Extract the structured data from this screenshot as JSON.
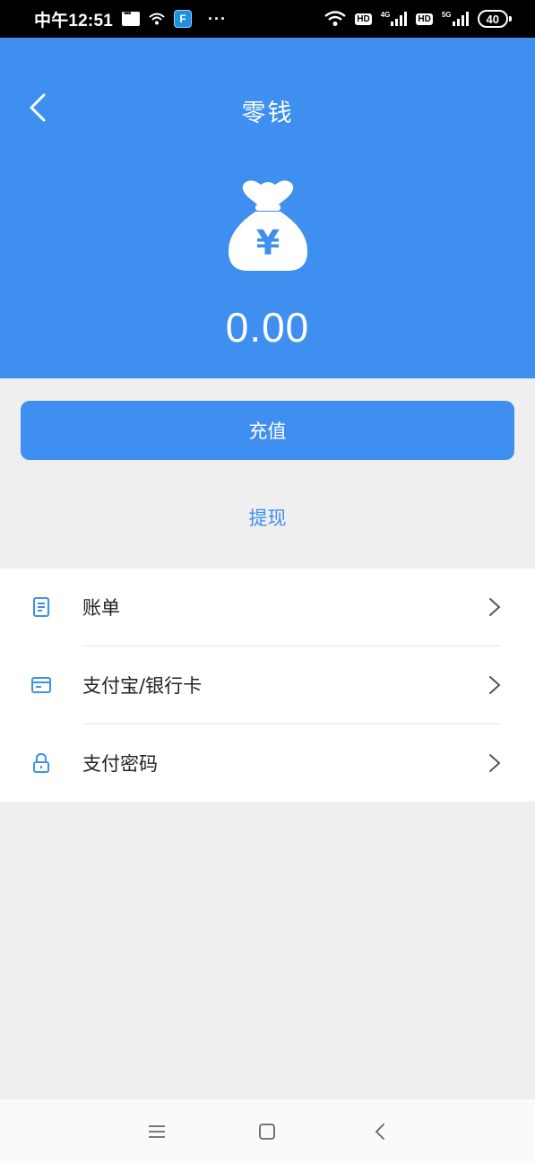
{
  "status_bar": {
    "time": "中午12:51",
    "app_badge": "F",
    "dots": "···",
    "hd1": "HD",
    "net1": "4G",
    "hd2": "HD",
    "net2": "5G",
    "battery": "40"
  },
  "header": {
    "title": "零钱",
    "balance": "0.00",
    "currency_symbol": "¥",
    "bg_color": "#3f8ff0"
  },
  "actions": {
    "recharge_label": "充值",
    "withdraw_label": "提现"
  },
  "menu": {
    "items": [
      {
        "label": "账单",
        "icon": "bill-icon"
      },
      {
        "label": "支付宝/银行卡",
        "icon": "card-icon"
      },
      {
        "label": "支付密码",
        "icon": "lock-icon"
      }
    ]
  },
  "icons": {
    "back": "back-icon",
    "moneybag": "moneybag-icon",
    "chevron": "chevron-right-icon"
  }
}
